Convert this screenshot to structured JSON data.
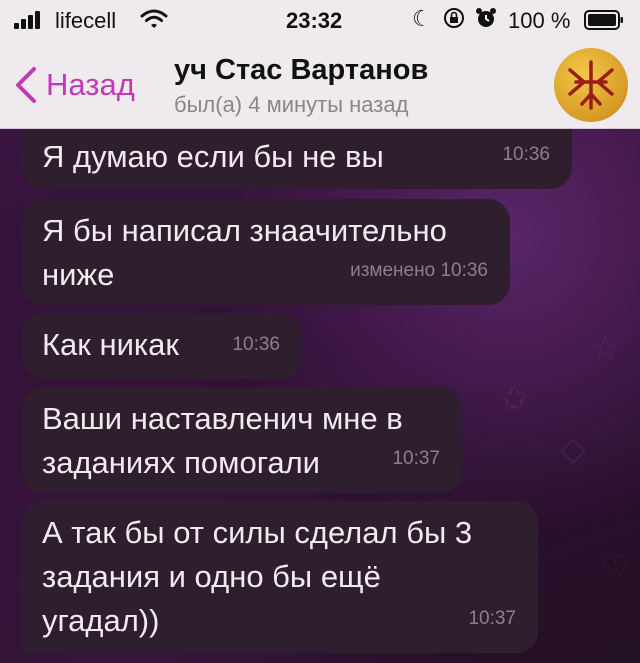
{
  "status_bar": {
    "carrier": "lifecell",
    "time": "23:32",
    "battery_percent": "100 %"
  },
  "header": {
    "back_label": "Назад",
    "title": "уч Стас Вартанов",
    "subtitle": "был(а) 4 минуты назад"
  },
  "messages": [
    {
      "lines": [
        "Я думаю если бы не вы"
      ],
      "time": "10:36"
    },
    {
      "lines": [
        "Я бы написал знаачительно",
        "ниже"
      ],
      "time": "изменено 10:36"
    },
    {
      "lines": [
        "Как никак"
      ],
      "time": "10:36"
    },
    {
      "lines": [
        "Ваши наставленич мне в",
        "заданиях помогали"
      ],
      "time": "10:37"
    },
    {
      "lines": [
        "А так бы от силы сделал бы 3",
        "задания и одно бы ещё",
        "угадал))"
      ],
      "time": "10:37"
    }
  ],
  "colors": {
    "accent": "#c13ab3",
    "bubble": "#2f1f2e",
    "bar_bg": "#efeaee"
  }
}
